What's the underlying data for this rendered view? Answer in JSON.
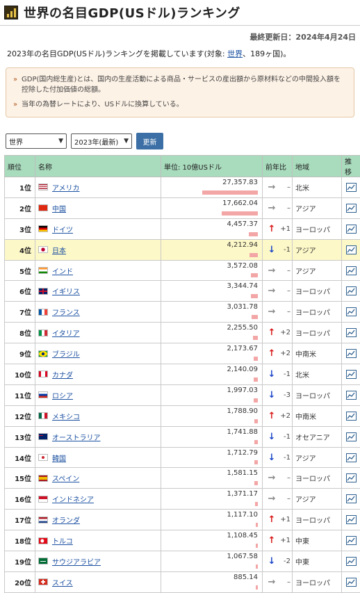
{
  "page": {
    "title": "世界の名目GDP(USドル)ランキング",
    "updated": "最終更新日：2024年4月24日",
    "intro_prefix": "2023年の名目GDP(USドル)ランキングを掲載しています(対象: ",
    "intro_link": "世界",
    "intro_suffix": "、189ヶ国)。"
  },
  "notes": [
    "GDP(国内総生産)とは、国内の生産活動による商品・サービスの産出額から原材料などの中間投入額を控除した付加価値の総額。",
    "当年の為替レートにより、USドルに換算している。"
  ],
  "controls": {
    "area": "世界",
    "year": "2023年(最新)",
    "update_button": "更新"
  },
  "table": {
    "headers": {
      "rank": "順位",
      "name": "名称",
      "value": "単位: 10億USドル",
      "change": "前年比",
      "region": "地域",
      "trend": "推移"
    },
    "rows": [
      {
        "rank": "1位",
        "country": "アメリカ",
        "value": "27,357.83",
        "amount": 27357.83,
        "dir": "flat",
        "delta": "–",
        "region": "北米",
        "flag": "us"
      },
      {
        "rank": "2位",
        "country": "中国",
        "value": "17,662.04",
        "amount": 17662.04,
        "dir": "flat",
        "delta": "–",
        "region": "アジア",
        "flag": "cn"
      },
      {
        "rank": "3位",
        "country": "ドイツ",
        "value": "4,457.37",
        "amount": 4457.37,
        "dir": "up",
        "delta": "+1",
        "region": "ヨーロッパ",
        "flag": "de"
      },
      {
        "rank": "4位",
        "country": "日本",
        "value": "4,212.94",
        "amount": 4212.94,
        "dir": "down",
        "delta": "-1",
        "region": "アジア",
        "flag": "jp",
        "highlight": true
      },
      {
        "rank": "5位",
        "country": "インド",
        "value": "3,572.08",
        "amount": 3572.08,
        "dir": "flat",
        "delta": "–",
        "region": "アジア",
        "flag": "in"
      },
      {
        "rank": "6位",
        "country": "イギリス",
        "value": "3,344.74",
        "amount": 3344.74,
        "dir": "flat",
        "delta": "–",
        "region": "ヨーロッパ",
        "flag": "gb"
      },
      {
        "rank": "7位",
        "country": "フランス",
        "value": "3,031.78",
        "amount": 3031.78,
        "dir": "flat",
        "delta": "–",
        "region": "ヨーロッパ",
        "flag": "fr"
      },
      {
        "rank": "8位",
        "country": "イタリア",
        "value": "2,255.50",
        "amount": 2255.5,
        "dir": "up",
        "delta": "+2",
        "region": "ヨーロッパ",
        "flag": "it"
      },
      {
        "rank": "9位",
        "country": "ブラジル",
        "value": "2,173.67",
        "amount": 2173.67,
        "dir": "up",
        "delta": "+2",
        "region": "中南米",
        "flag": "br"
      },
      {
        "rank": "10位",
        "country": "カナダ",
        "value": "2,140.09",
        "amount": 2140.09,
        "dir": "down",
        "delta": "-1",
        "region": "北米",
        "flag": "ca"
      },
      {
        "rank": "11位",
        "country": "ロシア",
        "value": "1,997.03",
        "amount": 1997.03,
        "dir": "down",
        "delta": "-3",
        "region": "ヨーロッパ",
        "flag": "ru"
      },
      {
        "rank": "12位",
        "country": "メキシコ",
        "value": "1,788.90",
        "amount": 1788.9,
        "dir": "up",
        "delta": "+2",
        "region": "中南米",
        "flag": "mx"
      },
      {
        "rank": "13位",
        "country": "オーストラリア",
        "value": "1,741.88",
        "amount": 1741.88,
        "dir": "down",
        "delta": "-1",
        "region": "オセアニア",
        "flag": "au"
      },
      {
        "rank": "14位",
        "country": "韓国",
        "value": "1,712.79",
        "amount": 1712.79,
        "dir": "down",
        "delta": "-1",
        "region": "アジア",
        "flag": "kr"
      },
      {
        "rank": "15位",
        "country": "スペイン",
        "value": "1,581.15",
        "amount": 1581.15,
        "dir": "flat",
        "delta": "–",
        "region": "ヨーロッパ",
        "flag": "es"
      },
      {
        "rank": "16位",
        "country": "インドネシア",
        "value": "1,371.17",
        "amount": 1371.17,
        "dir": "flat",
        "delta": "–",
        "region": "アジア",
        "flag": "id"
      },
      {
        "rank": "17位",
        "country": "オランダ",
        "value": "1,117.10",
        "amount": 1117.1,
        "dir": "up",
        "delta": "+1",
        "region": "ヨーロッパ",
        "flag": "nl"
      },
      {
        "rank": "18位",
        "country": "トルコ",
        "value": "1,108.45",
        "amount": 1108.45,
        "dir": "up",
        "delta": "+1",
        "region": "中東",
        "flag": "tr"
      },
      {
        "rank": "19位",
        "country": "サウジアラビア",
        "value": "1,067.58",
        "amount": 1067.58,
        "dir": "down",
        "delta": "-2",
        "region": "中東",
        "flag": "sa"
      },
      {
        "rank": "20位",
        "country": "スイス",
        "value": "885.14",
        "amount": 885.14,
        "dir": "flat",
        "delta": "–",
        "region": "ヨーロッパ",
        "flag": "ch"
      }
    ]
  },
  "colors": {
    "header_bg": "#a9dbbd",
    "bar": "#f3a6a6",
    "highlight": "#fdf8c8",
    "up": "#d81818",
    "down": "#1a45c8",
    "flat": "#8a8a8a",
    "link": "#1a4fa0"
  }
}
